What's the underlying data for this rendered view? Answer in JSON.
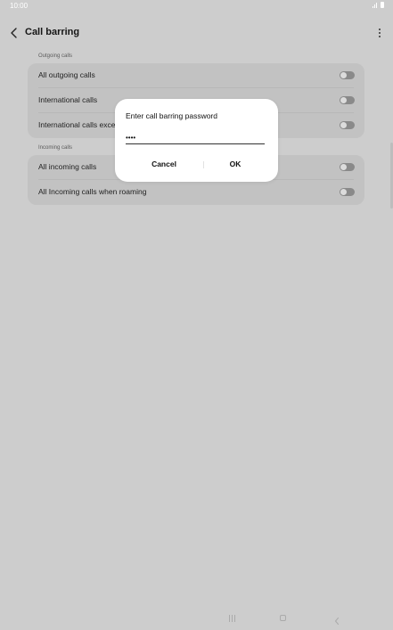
{
  "status_bar": {
    "time": "10:00",
    "icons": [
      "signal-icon",
      "battery-icon"
    ]
  },
  "app_bar": {
    "title": "Call barring",
    "icons": [
      "chevron-left-icon",
      "more-vertical-icon"
    ]
  },
  "sections": [
    {
      "header": "Outgoing calls",
      "items": [
        {
          "label": "All outgoing calls",
          "enabled": false
        },
        {
          "label": "International calls",
          "enabled": false
        },
        {
          "label": "International calls exce",
          "enabled": false
        }
      ]
    },
    {
      "header": "Incoming calls",
      "items": [
        {
          "label": "All incoming calls",
          "enabled": false
        },
        {
          "label": "All Incoming calls when roaming",
          "enabled": false
        }
      ]
    }
  ],
  "dialog": {
    "title": "Enter call barring password",
    "password_value": "••••",
    "cancel_label": "Cancel",
    "ok_label": "OK"
  },
  "nav_bar": {
    "icons": [
      "recents-icon",
      "home-icon",
      "back-icon"
    ]
  },
  "colors": {
    "background": "#cdcdcd",
    "card": "#c2c2c2",
    "dialog": "#ffffff",
    "toggle_off": "#8a8a8a"
  }
}
